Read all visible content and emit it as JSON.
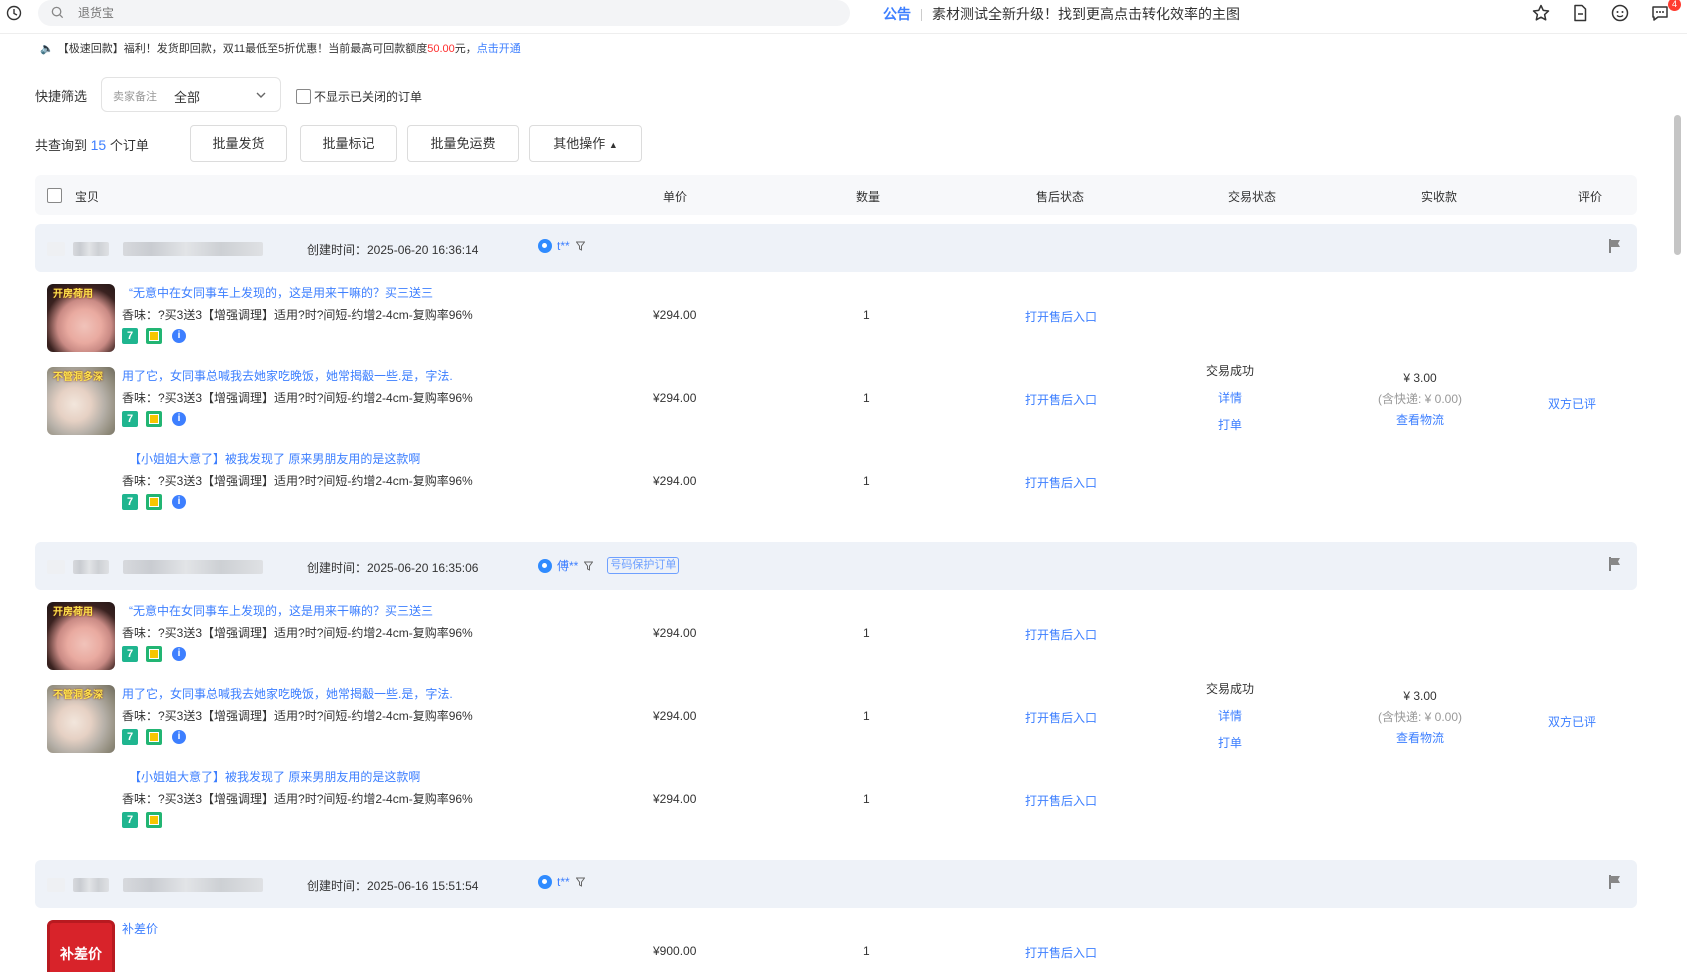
{
  "topbar": {
    "search_placeholder": "退货宝",
    "notice_tag": "公告",
    "notice_text": "素材测试全新升级！找到更高点击转化效率的主图",
    "badge_count": "4"
  },
  "promo": {
    "prefix": "【极速回款】福利！发货即回款，双11最低至5折优惠！当前最高可回款额度",
    "amount": "50.00",
    "suffix": "元，",
    "link": "点击开通"
  },
  "filter": {
    "label": "快捷筛选",
    "select_placeholder": "卖家备注",
    "select_value": "全部",
    "checkbox_label": "不显示已关闭的订单"
  },
  "summary": {
    "prefix": "共查询到",
    "count": "15",
    "suffix": "个订单",
    "buttons": [
      "批量发货",
      "批量标记",
      "批量免运费",
      "其他操作"
    ]
  },
  "table_header": [
    "宝贝",
    "单价",
    "数量",
    "售后状态",
    "交易状态",
    "实收款",
    "评价"
  ],
  "orders": [
    {
      "created": "创建时间：2025-06-20 16:36:14",
      "buyer": "t**",
      "items": [
        {
          "thumb_label": "开房荷用",
          "name": "“无意中在女同事车上发现的，这是用来干嘛的？买三送三",
          "sku": "香味：?买3送3【增强调理】适用?时?间短-约增2-4cm-复购率96%",
          "price": "¥294.00",
          "qty": "1",
          "after": "打开售后入口"
        },
        {
          "thumb_label": "不管洞多深",
          "name": "用了它，女同事总喊我去她家吃晚饭，她常揭觳一些.是，字法.",
          "sku": "香味：?买3送3【增强调理】适用?时?间短-约增2-4cm-复购率96%",
          "price": "¥294.00",
          "qty": "1",
          "after": "打开售后入口"
        },
        {
          "thumb_label": "",
          "name": "【小姐姐大意了】被我发现了 原来男朋友用的是这款啊",
          "sku": "香味：?买3送3【增强调理】适用?时?间短-约增2-4cm-复购率96%",
          "price": "¥294.00",
          "qty": "1",
          "after": "打开售后入口"
        }
      ],
      "trade": {
        "status": "交易成功",
        "detail": "详情",
        "print": "打单"
      },
      "pay": {
        "amount": "¥ 3.00",
        "shipping": "(含快递: ¥ 0.00)",
        "logistics": "查看物流"
      },
      "eval": "双方已评"
    },
    {
      "created": "创建时间：2025-06-20 16:35:06",
      "buyer": "傅**",
      "protect": "号码保护订单",
      "items": [
        {
          "thumb_label": "开房荷用",
          "name": "“无意中在女同事车上发现的，这是用来干嘛的？买三送三",
          "sku": "香味：?买3送3【增强调理】适用?时?间短-约增2-4cm-复购率96%",
          "price": "¥294.00",
          "qty": "1",
          "after": "打开售后入口"
        },
        {
          "thumb_label": "不管洞多深",
          "name": "用了它，女同事总喊我去她家吃晚饭，她常揭觳一些.是，字法.",
          "sku": "香味：?买3送3【增强调理】适用?时?间短-约增2-4cm-复购率96%",
          "price": "¥294.00",
          "qty": "1",
          "after": "打开售后入口"
        },
        {
          "thumb_label": "",
          "name": "【小姐姐大意了】被我发现了 原来男朋友用的是这款啊",
          "sku": "香味：?买3送3【增强调理】适用?时?间短-约增2-4cm-复购率96%",
          "price": "¥294.00",
          "qty": "1",
          "after": "打开售后入口"
        }
      ],
      "trade": {
        "status": "交易成功",
        "detail": "详情",
        "print": "打单"
      },
      "pay": {
        "amount": "¥ 3.00",
        "shipping": "(含快递: ¥ 0.00)",
        "logistics": "查看物流"
      },
      "eval": "双方已评"
    },
    {
      "created": "创建时间：2025-06-16 15:51:54",
      "buyer": "t**",
      "items": [
        {
          "thumb_label": "补差价",
          "name": "补差价",
          "sku": "",
          "price": "¥900.00",
          "qty": "1",
          "after": "打开售后入口"
        }
      ]
    }
  ]
}
